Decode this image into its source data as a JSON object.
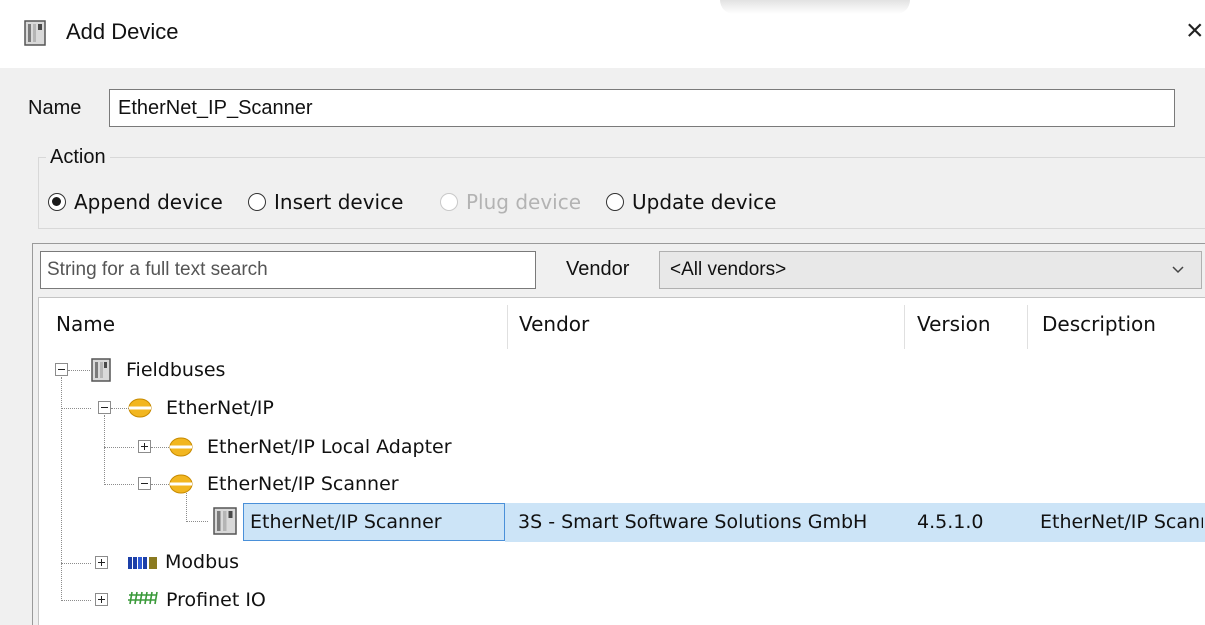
{
  "window": {
    "title": "Add Device",
    "close_glyph": "×",
    "title_icon": "device-icon",
    "close_icon": "close-icon"
  },
  "name_field": {
    "label": "Name",
    "value": "EtherNet_IP_Scanner"
  },
  "action": {
    "legend": "Action",
    "options": [
      {
        "label": "Append device",
        "checked": true,
        "disabled": false
      },
      {
        "label": "Insert device",
        "checked": false,
        "disabled": false
      },
      {
        "label": "Plug device",
        "checked": false,
        "disabled": true
      },
      {
        "label": "Update device",
        "checked": false,
        "disabled": false
      }
    ]
  },
  "search": {
    "placeholder": "String for a full text search",
    "vendor_label": "Vendor",
    "vendor_selected": "<All vendors>",
    "vendor_chevron_icon": "chevron-down-icon"
  },
  "tree": {
    "columns": [
      "Name",
      "Vendor",
      "Version",
      "Description"
    ],
    "nodes": [
      {
        "label": "Fieldbuses",
        "level": 0,
        "expanded": true,
        "icon": "device-icon"
      },
      {
        "label": "EtherNet/IP",
        "level": 1,
        "expanded": true,
        "icon": "ethernet-ip-icon"
      },
      {
        "label": "EtherNet/IP Local Adapter",
        "level": 2,
        "expanded": false,
        "icon": "ethernet-ip-icon"
      },
      {
        "label": "EtherNet/IP Scanner",
        "level": 2,
        "expanded": true,
        "icon": "ethernet-ip-icon"
      },
      {
        "label": "EtherNet/IP Scanner",
        "level": 3,
        "icon": "device-icon",
        "selected": true,
        "vendor": "3S - Smart Software Solutions GmbH",
        "version": "4.5.1.0",
        "description": "EtherNet/IP Scanner"
      },
      {
        "label": "Modbus",
        "level": 1,
        "expanded": false,
        "icon": "modbus-icon"
      },
      {
        "label": "Profinet IO",
        "level": 1,
        "expanded": false,
        "icon": "profinet-icon"
      }
    ]
  },
  "colors": {
    "dialog_bg": "#f0f0f0",
    "selection": "#cce4f7",
    "selection_border": "#4a90d9",
    "ethernet_icon": "#e8a317"
  }
}
